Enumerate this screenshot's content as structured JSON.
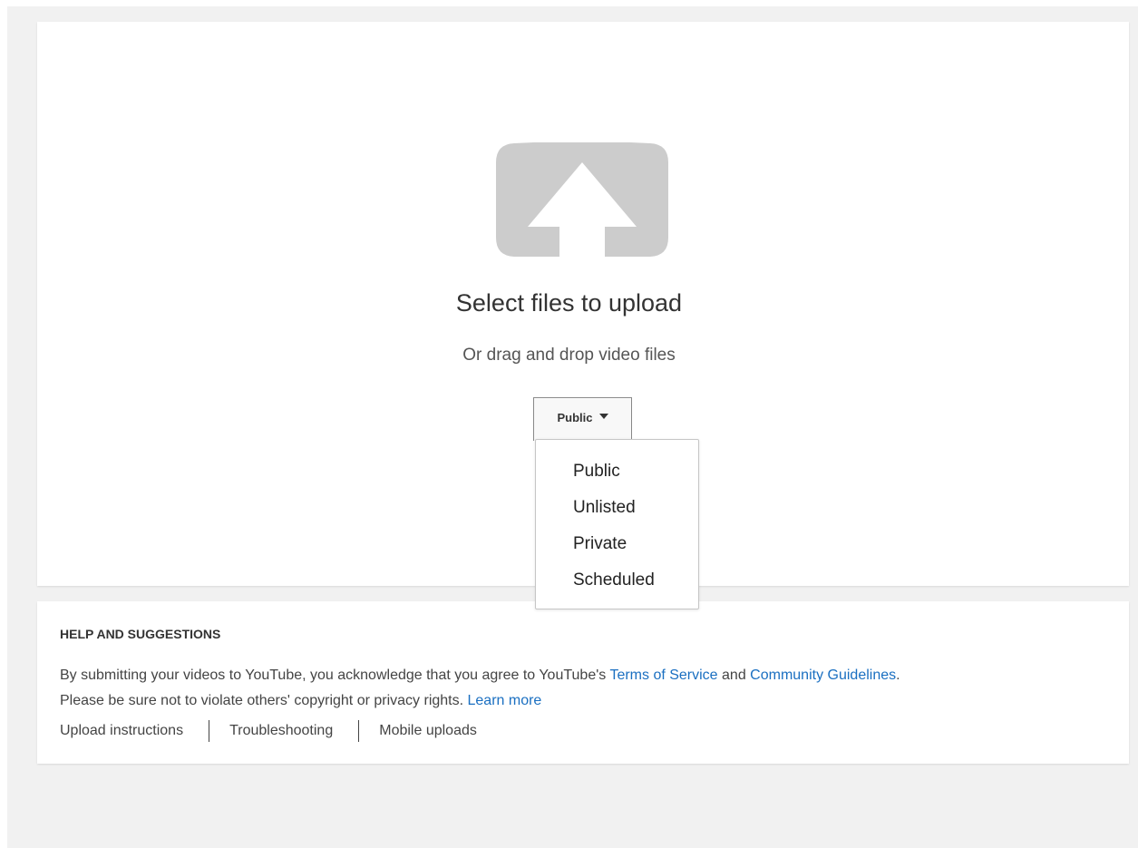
{
  "upload": {
    "icon": "upload-arrow-icon",
    "title": "Select files to upload",
    "subtitle": "Or drag and drop video files"
  },
  "privacy": {
    "selected": "Public",
    "options": [
      "Public",
      "Unlisted",
      "Private",
      "Scheduled"
    ]
  },
  "help": {
    "heading": "HELP AND SUGGESTIONS",
    "line1_pre": "By submitting your videos to YouTube, you acknowledge that you agree to YouTube's ",
    "terms_link": "Terms of Service",
    "line1_mid": " and ",
    "guidelines_link": "Community Guidelines",
    "line1_post": ".",
    "line2_pre": "Please be sure not to violate others' copyright or privacy rights. ",
    "learn_more_link": "Learn more",
    "links": [
      "Upload instructions",
      "Troubleshooting",
      "Mobile uploads"
    ]
  },
  "colors": {
    "link": "#1a6fc1",
    "icon": "#cccccc",
    "background": "#f1f1f1"
  }
}
